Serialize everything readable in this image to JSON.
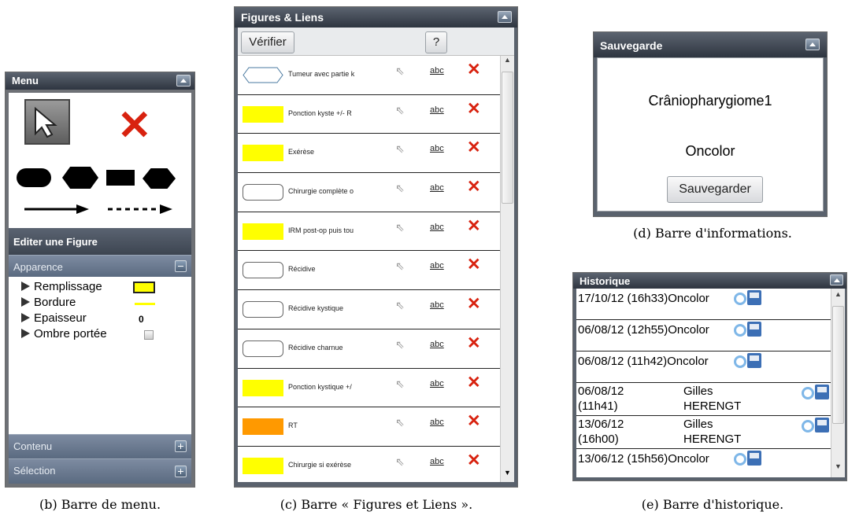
{
  "menu": {
    "title": "Menu",
    "edit_section": "Editer une Figure",
    "appearance_label": "Apparence",
    "properties": [
      {
        "label": "Remplissage"
      },
      {
        "label": "Bordure"
      },
      {
        "label": "Epaisseur",
        "value": "0"
      },
      {
        "label": "Ombre portée"
      }
    ],
    "fill_color": "#ffff00",
    "border_color": "#ffff00",
    "content_label": "Contenu",
    "selection_label": "Sélection",
    "caption": "(b) Barre de menu."
  },
  "figures": {
    "title": "Figures & Liens",
    "verify_label": "Vérifier",
    "help_label": "?",
    "link_text": "abc",
    "rows": [
      {
        "label": "Tumeur avec partie k",
        "shape": "hexagon",
        "color": "#ffffff"
      },
      {
        "label": "Ponction kyste +/- R",
        "shape": "rect",
        "color": "#ffff00"
      },
      {
        "label": "Exérèse",
        "shape": "rect",
        "color": "#ffff00"
      },
      {
        "label": "Chirurgie complète o",
        "shape": "rounded",
        "color": "#ffffff"
      },
      {
        "label": "IRM post-op puis tou",
        "shape": "rect",
        "color": "#ffff00"
      },
      {
        "label": "Récidive",
        "shape": "rounded",
        "color": "#ffffff"
      },
      {
        "label": "Récidive kystique",
        "shape": "rounded",
        "color": "#ffffff"
      },
      {
        "label": "Récidive charnue",
        "shape": "rounded",
        "color": "#ffffff"
      },
      {
        "label": "Ponction kystique +/",
        "shape": "rect",
        "color": "#ffff00"
      },
      {
        "label": "RT",
        "shape": "rect",
        "color": "#ff9900"
      },
      {
        "label": "Chirurgie si exérèse",
        "shape": "rect",
        "color": "#ffff00"
      }
    ],
    "caption": "(c) Barre « Figures et Liens »."
  },
  "save": {
    "title": "Sauvegarde",
    "filename": "Crâniopharygiome1",
    "author": "Oncolor",
    "button_label": "Sauvegarder",
    "caption": "(d) Barre d'informations."
  },
  "history": {
    "title": "Historique",
    "rows": [
      {
        "line1": "17/10/12 (16h33)Oncolor"
      },
      {
        "line1": "06/08/12 (12h55)Oncolor"
      },
      {
        "line1": "06/08/12 (11h42)Oncolor"
      },
      {
        "date": "06/08/12",
        "time": "(11h41)",
        "first": "Gilles",
        "last": "HERENGT"
      },
      {
        "date": "13/06/12",
        "time": "(16h00)",
        "first": "Gilles",
        "last": "HERENGT"
      },
      {
        "line1": "13/06/12 (15h56)Oncolor"
      }
    ],
    "caption": "(e) Barre d'historique."
  }
}
